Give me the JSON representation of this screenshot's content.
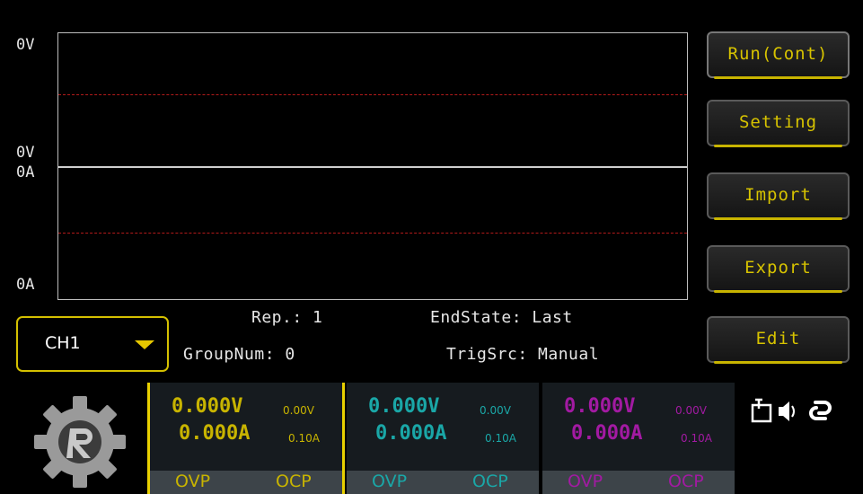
{
  "plot": {
    "v_top": "0V",
    "v_bottom": "0V",
    "a_top": "0A",
    "a_bottom": "0A"
  },
  "buttons": {
    "run": "Run(Cont)",
    "setting": "Setting",
    "import": "Import",
    "export": "Export",
    "edit": "Edit"
  },
  "channel_select": {
    "value": "CH1"
  },
  "info": {
    "rep": "Rep.: 1",
    "group_num": "GroupNum: 0",
    "end_state": "EndState: Last",
    "trig_src": "TrigSrc: Manual"
  },
  "channels": [
    {
      "voltage": "0.000V",
      "current": "0.000A",
      "v_set": "0.00V",
      "a_set": "0.10A",
      "ovp": "OVP",
      "ocp": "OCP",
      "color": "#c8b400"
    },
    {
      "voltage": "0.000V",
      "current": "0.000A",
      "v_set": "0.00V",
      "a_set": "0.10A",
      "ovp": "OVP",
      "ocp": "OCP",
      "color": "#1aa7a7"
    },
    {
      "voltage": "0.000V",
      "current": "0.000A",
      "v_set": "0.00V",
      "a_set": "0.10A",
      "ovp": "OVP",
      "ocp": "OCP",
      "color": "#a21aa2"
    }
  ],
  "status_icons": [
    "remote-interface-icon",
    "speaker-icon",
    "link-icon"
  ]
}
